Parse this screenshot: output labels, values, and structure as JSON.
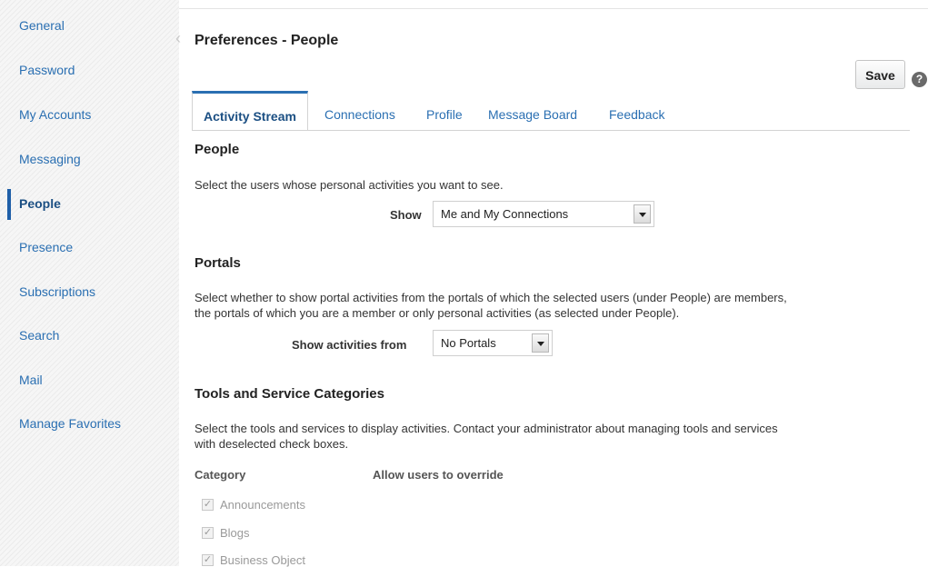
{
  "sidebar": {
    "items": [
      {
        "label": "General"
      },
      {
        "label": "Password"
      },
      {
        "label": "My Accounts"
      },
      {
        "label": "Messaging"
      },
      {
        "label": "People"
      },
      {
        "label": "Presence"
      },
      {
        "label": "Subscriptions"
      },
      {
        "label": "Search"
      },
      {
        "label": "Mail"
      },
      {
        "label": "Manage Favorites"
      }
    ],
    "active": "People"
  },
  "header": {
    "title": "Preferences - People",
    "save_label": "Save",
    "help_glyph": "?"
  },
  "tabs": [
    {
      "label": "Activity Stream"
    },
    {
      "label": "Connections"
    },
    {
      "label": "Profile"
    },
    {
      "label": "Message Board"
    },
    {
      "label": "Feedback"
    }
  ],
  "people": {
    "heading": "People",
    "description": "Select the users whose personal activities you want to see.",
    "show_label": "Show",
    "show_value": "Me and My Connections"
  },
  "portals": {
    "heading": "Portals",
    "description_line1": "Select whether to show portal activities from the portals of which the selected users (under People) are members,",
    "description_line2": "the portals of which you are a member or only personal activities (as selected under People).",
    "show_from_label": "Show activities from",
    "show_from_value": "No Portals"
  },
  "tools": {
    "heading": "Tools and Service Categories",
    "description_line1": "Select the tools and services to display activities. Contact your administrator about managing tools and services",
    "description_line2": "with deselected check boxes.",
    "col_category": "Category",
    "col_override": "Allow users to override",
    "categories": [
      {
        "label": "Announcements",
        "checked": true
      },
      {
        "label": "Blogs",
        "checked": true
      },
      {
        "label": "Business Object",
        "checked": true
      }
    ]
  },
  "colors": {
    "link": "#2a6fb2",
    "active_indicator": "#1f5fa8"
  },
  "icons": {
    "help": "help-circle-icon",
    "collapse": "chevron-left-icon",
    "dropdown": "triangle-down-icon",
    "checkbox": "checkmark-icon"
  }
}
